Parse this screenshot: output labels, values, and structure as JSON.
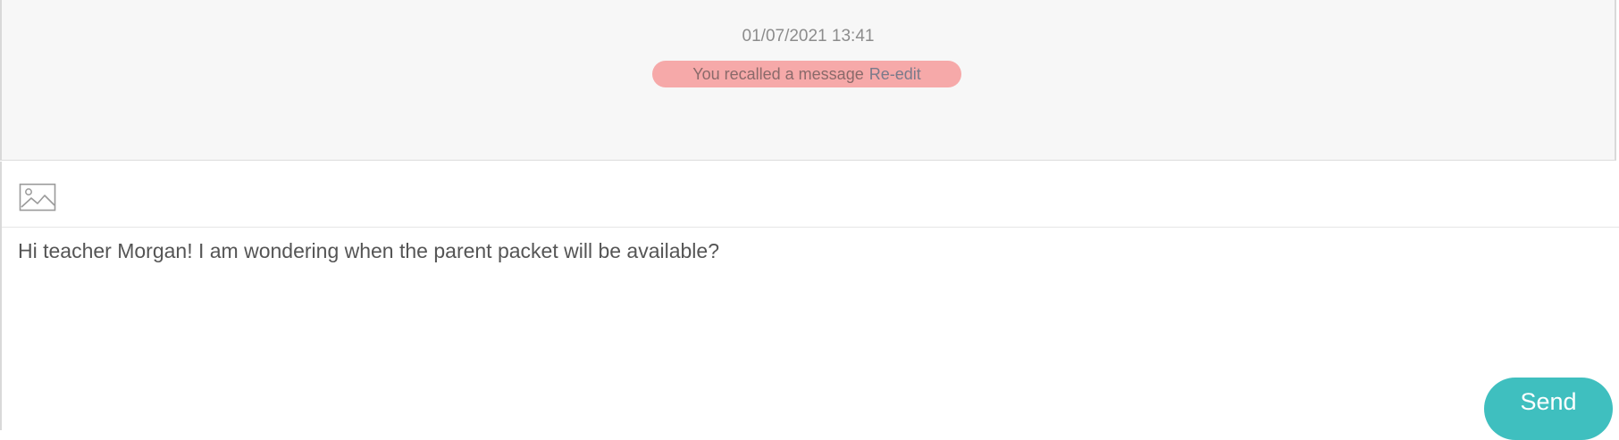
{
  "chat": {
    "timestamp": "01/07/2021 13:41",
    "recall_notice": {
      "text": "You recalled a message",
      "action_label": "Re-edit",
      "background_color": "#f6a9a9"
    }
  },
  "composer": {
    "toolbar": {
      "image_icon": "image-icon"
    },
    "message_value": "Hi teacher Morgan! I am wondering when the parent packet will be available?",
    "send_label": "Send",
    "send_color": "#3fbfbf"
  }
}
